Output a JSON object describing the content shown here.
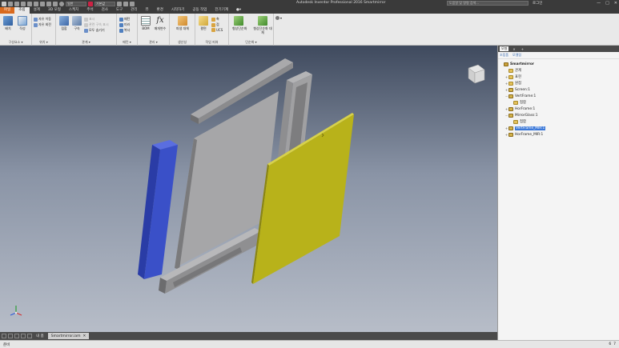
{
  "titlebar": {
    "app_title": "Autodesk Inventor Professional 2016    Smartmirror",
    "material_combo": "일반",
    "appearance_combo": "기본값",
    "search_placeholder": "도움말 및 명령 검색...",
    "user_label": "로그인",
    "window_controls": [
      "—",
      "□",
      "✕"
    ]
  },
  "ribbon_tabs": [
    "파일",
    "조립",
    "설계",
    "3D 모형",
    "스케치",
    "주석",
    "검사",
    "도구",
    "관리",
    "뷰",
    "환경",
    "시작하기",
    "공동 작업",
    "전기기계"
  ],
  "ribbon": {
    "panel_component": {
      "label": "구성요소 ▾",
      "place": "배치",
      "create": "작성"
    },
    "panel_position": {
      "label": "위치 ▾",
      "free_move": "자유 이동",
      "free_rotate": "자유 회전"
    },
    "panel_relationships": {
      "label": "관계 ▾",
      "joint": "접합",
      "constrain": "구속",
      "show": "표시",
      "show_sick": "관련 구속 표시",
      "hide_all": "모두 숨기기"
    },
    "panel_pattern": {
      "label": "패턴 ▾",
      "pattern": "패턴",
      "mirror": "미러",
      "copy": "복사"
    },
    "panel_manage": {
      "label": "관리 ▾",
      "bom": "BOM",
      "parameters": "매개변수"
    },
    "panel_productivity": {
      "label": "생산성",
      "replace": "파생 대체"
    },
    "panel_work_features": {
      "label": "작업 피쳐",
      "plane": "평면",
      "axis": "축",
      "point": "점",
      "ucs": "UCS"
    },
    "panel_simplification": {
      "label": "단순화 ▾",
      "shrinkwrap": "형상단순화",
      "shrinkwrap_sub": "형상단순화 대체"
    }
  },
  "doc_tabs": {
    "home": "내 홈",
    "active_doc": "Smartmirror.iam"
  },
  "status": {
    "left": "준비",
    "right_a": "6",
    "right_b": "7"
  },
  "browser": {
    "tab_model": "모형",
    "sub_assembly": "조립품",
    "sub_view": "모델링",
    "tree": [
      {
        "label": "Smartmirror",
        "level": 0,
        "icon": "assembly-icon",
        "toggle": ""
      },
      {
        "label": "관계",
        "level": 1,
        "icon": "folder-icon",
        "toggle": ""
      },
      {
        "label": "표현",
        "level": 1,
        "icon": "folder-icon",
        "toggle": "+"
      },
      {
        "label": "원점",
        "level": 1,
        "icon": "folder-icon",
        "toggle": "+"
      },
      {
        "label": "Screen:1",
        "level": 1,
        "icon": "part-icon",
        "toggle": "+"
      },
      {
        "label": "VertFrame:1",
        "level": 1,
        "icon": "part-icon",
        "toggle": "−"
      },
      {
        "label": "접합",
        "level": 2,
        "icon": "folder-icon",
        "toggle": ""
      },
      {
        "label": "HorFrame:1",
        "level": 1,
        "icon": "part-icon",
        "toggle": "+"
      },
      {
        "label": "MirrorGlass:1",
        "level": 1,
        "icon": "part-icon",
        "toggle": "−"
      },
      {
        "label": "접합",
        "level": 2,
        "icon": "folder-icon",
        "toggle": ""
      },
      {
        "label": "VertFrame_MIR:1",
        "level": 1,
        "icon": "part-icon",
        "toggle": "+",
        "selected": true
      },
      {
        "label": "HorFrame_MIR:1",
        "level": 1,
        "icon": "part-icon",
        "toggle": "+"
      }
    ]
  },
  "colors": {
    "accent_orange": "#d96a1e",
    "selection_blue": "#3b78d8",
    "mirror_glass": "#b8b21a",
    "vert_frame_mir": "#3a50c8"
  }
}
